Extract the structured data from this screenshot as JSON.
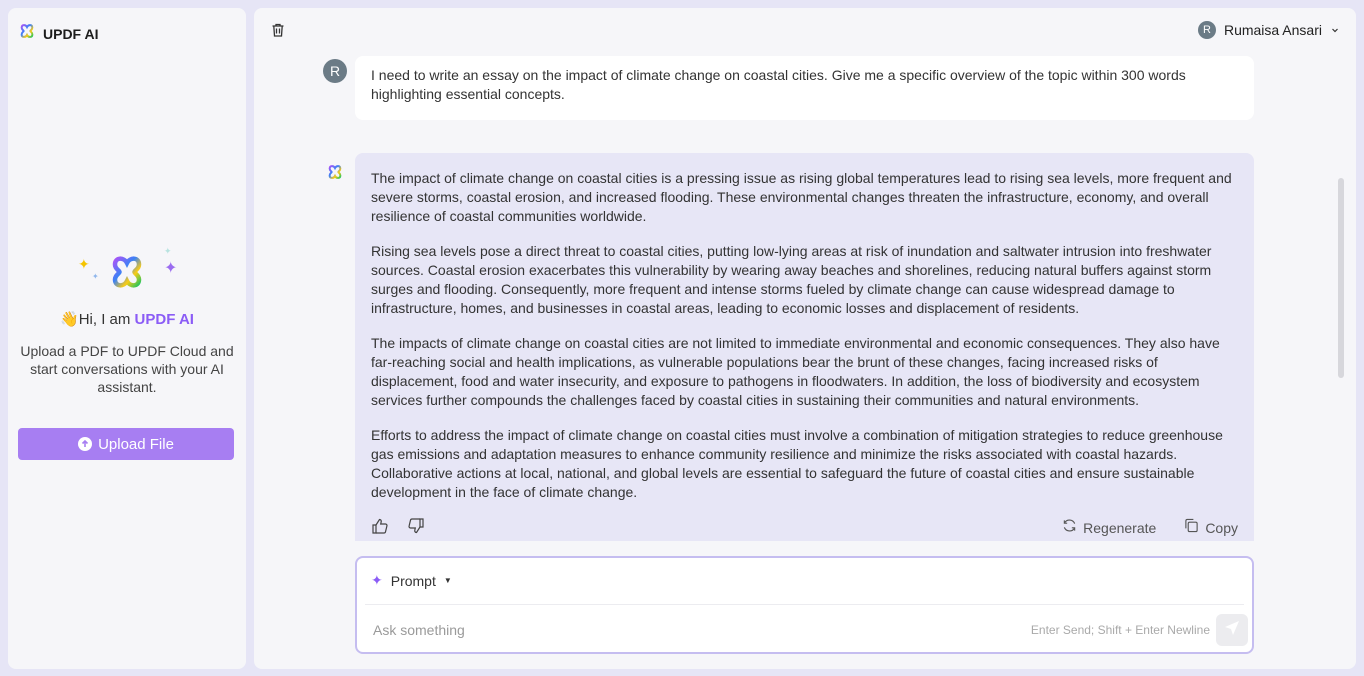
{
  "sidebar": {
    "brand": "UPDF AI",
    "greeting_prefix": "Hi, I am ",
    "greeting_emoji": "👋",
    "greeting_accent": "UPDF AI",
    "description": "Upload a PDF to UPDF Cloud and start conversations with your AI assistant.",
    "upload_button": "Upload File"
  },
  "header": {
    "user_initial": "R",
    "user_name": "Rumaisa Ansari"
  },
  "conversation": {
    "user_initial": "R",
    "user_message": "I need to write an essay on the impact of climate change on coastal cities. Give me a specific overview of the topic within 300 words highlighting essential concepts.",
    "ai_paragraphs": [
      "The impact of climate change on coastal cities is a pressing issue as rising global temperatures lead to rising sea levels, more frequent and severe storms, coastal erosion, and increased flooding. These environmental changes threaten the infrastructure, economy, and overall resilience of coastal communities worldwide.",
      "Rising sea levels pose a direct threat to coastal cities, putting low-lying areas at risk of inundation and saltwater intrusion into freshwater sources. Coastal erosion exacerbates this vulnerability by wearing away beaches and shorelines, reducing natural buffers against storm surges and flooding. Consequently, more frequent and intense storms fueled by climate change can cause widespread damage to infrastructure, homes, and businesses in coastal areas, leading to economic losses and displacement of residents.",
      "The impacts of climate change on coastal cities are not limited to immediate environmental and economic consequences. They also have far-reaching social and health implications, as vulnerable populations bear the brunt of these changes, facing increased risks of displacement, food and water insecurity, and exposure to pathogens in floodwaters. In addition, the loss of biodiversity and ecosystem services further compounds the challenges faced by coastal cities in sustaining their communities and natural environments.",
      "Efforts to address the impact of climate change on coastal cities must involve a combination of mitigation strategies to reduce greenhouse gas emissions and adaptation measures to enhance community resilience and minimize the risks associated with coastal hazards. Collaborative actions at local, national, and global levels are essential to safeguard the future of coastal cities and ensure sustainable development in the face of climate change."
    ],
    "actions": {
      "regenerate": "Regenerate",
      "copy": "Copy"
    }
  },
  "composer": {
    "mode_label": "Prompt",
    "placeholder": "Ask something",
    "value": "",
    "hint": "Enter Send; Shift + Enter Newline"
  },
  "colors": {
    "accent": "#a77ef2",
    "ai_bubble": "#e7e6f6",
    "background": "#e6e5f6"
  }
}
